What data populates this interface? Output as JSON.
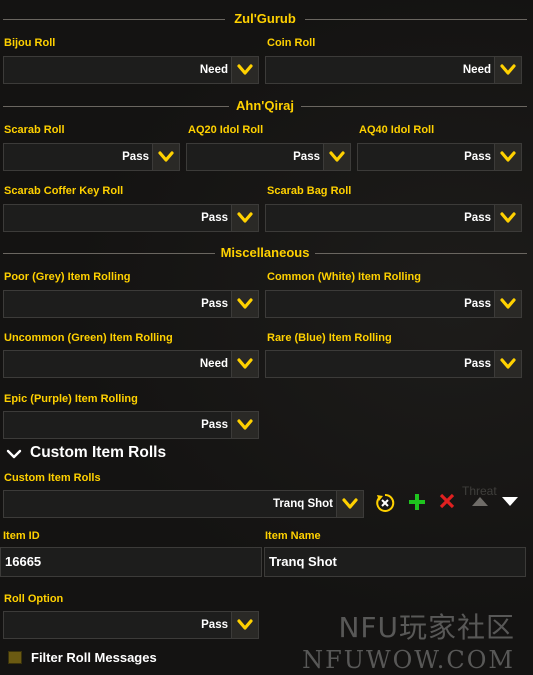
{
  "sections": {
    "zulgurub": "Zul'Gurub",
    "ahnqiraj": "Ahn'Qiraj",
    "misc": "Miscellaneous"
  },
  "zulgurub": {
    "bijou": {
      "label": "Bijou Roll",
      "value": "Need"
    },
    "coin": {
      "label": "Coin Roll",
      "value": "Need"
    }
  },
  "ahnqiraj": {
    "scarab": {
      "label": "Scarab Roll",
      "value": "Pass"
    },
    "aq20": {
      "label": "AQ20 Idol Roll",
      "value": "Pass"
    },
    "aq40": {
      "label": "AQ40 Idol Roll",
      "value": "Pass"
    },
    "coffer": {
      "label": "Scarab Coffer Key Roll",
      "value": "Pass"
    },
    "bag": {
      "label": "Scarab Bag Roll",
      "value": "Pass"
    }
  },
  "misc": {
    "poor": {
      "label": "Poor (Grey) Item Rolling",
      "value": "Pass"
    },
    "common": {
      "label": "Common (White) Item Rolling",
      "value": "Pass"
    },
    "uncommon": {
      "label": "Uncommon (Green) Item Rolling",
      "value": "Need"
    },
    "rare": {
      "label": "Rare (Blue) Item Rolling",
      "value": "Pass"
    },
    "epic": {
      "label": "Epic (Purple) Item Rolling",
      "value": "Pass"
    }
  },
  "custom": {
    "header": "Custom Item Rolls",
    "list_label": "Custom Item Rolls",
    "list_value": "Tranq Shot",
    "item_id_label": "Item ID",
    "item_id_value": "16665",
    "item_name_label": "Item Name",
    "item_name_value": "Tranq Shot",
    "roll_option_label": "Roll Option",
    "roll_option_value": "Pass"
  },
  "filter": {
    "label": "Filter Roll Messages",
    "checked": true
  },
  "background_text": "Threat",
  "watermark": {
    "line1": "NFU玩家社区",
    "line2": "NFUWOW.COM"
  },
  "colors": {
    "accent_gold": "#ffd100",
    "add_green": "#1ec41e",
    "delete_red": "#e02020"
  }
}
